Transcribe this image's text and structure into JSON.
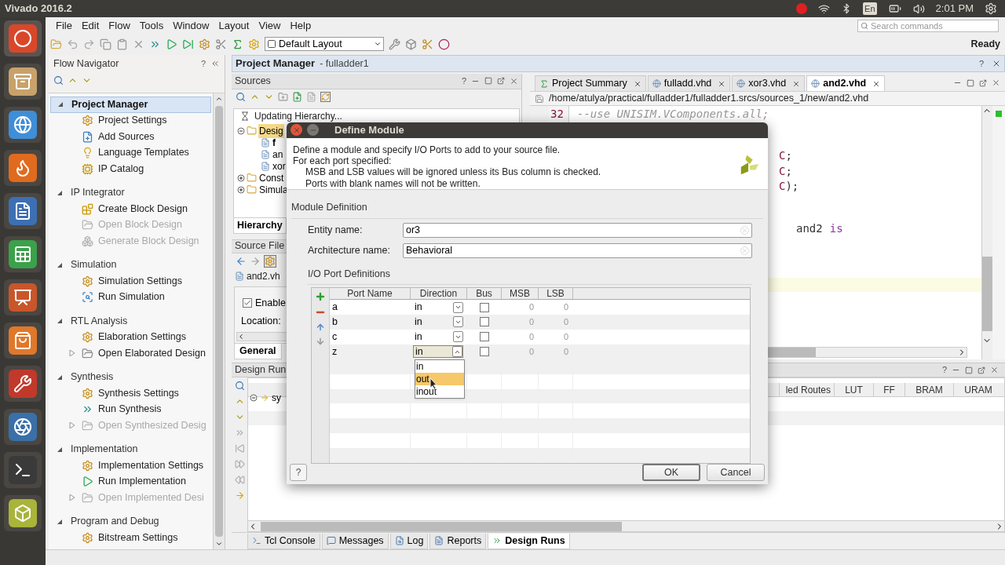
{
  "window": {
    "title": "Vivado 2016.2"
  },
  "system_tray": {
    "keyboard": "En",
    "time": "2:01 PM"
  },
  "menu": [
    "File",
    "Edit",
    "Flow",
    "Tools",
    "Window",
    "Layout",
    "View",
    "Help"
  ],
  "search": {
    "placeholder": "Search commands"
  },
  "toolbar": {
    "layout": "Default Layout",
    "status": "Ready"
  },
  "flow_navigator": {
    "title": "Flow Navigator",
    "help": "?",
    "sections": [
      {
        "label": "Project Manager",
        "selected": true,
        "expanded": true,
        "items": [
          {
            "label": "Project Settings",
            "kind": "settings",
            "disabled": false,
            "expandable": false
          },
          {
            "label": "Add Sources",
            "kind": "add",
            "disabled": false,
            "expandable": false
          },
          {
            "label": "Language Templates",
            "kind": "bulb",
            "disabled": false,
            "expandable": false
          },
          {
            "label": "IP Catalog",
            "kind": "catalog",
            "disabled": false,
            "expandable": false
          }
        ]
      },
      {
        "label": "IP Integrator",
        "selected": false,
        "expanded": true,
        "items": [
          {
            "label": "Create Block Design",
            "kind": "block",
            "disabled": false,
            "expandable": false
          },
          {
            "label": "Open Block Design",
            "kind": "open",
            "disabled": true,
            "expandable": false
          },
          {
            "label": "Generate Block Design",
            "kind": "generate",
            "disabled": true,
            "expandable": false
          }
        ]
      },
      {
        "label": "Simulation",
        "selected": false,
        "expanded": true,
        "items": [
          {
            "label": "Simulation Settings",
            "kind": "settings",
            "disabled": false,
            "expandable": false
          },
          {
            "label": "Run Simulation",
            "kind": "simulate",
            "disabled": false,
            "expandable": false
          }
        ]
      },
      {
        "label": "RTL Analysis",
        "selected": false,
        "expanded": true,
        "items": [
          {
            "label": "Elaboration Settings",
            "kind": "settings",
            "disabled": false,
            "expandable": false
          },
          {
            "label": "Open Elaborated Design",
            "kind": "open",
            "disabled": false,
            "expandable": true
          }
        ]
      },
      {
        "label": "Synthesis",
        "selected": false,
        "expanded": true,
        "items": [
          {
            "label": "Synthesis Settings",
            "kind": "settings",
            "disabled": false,
            "expandable": false
          },
          {
            "label": "Run Synthesis",
            "kind": "synth",
            "disabled": false,
            "expandable": false
          },
          {
            "label": "Open Synthesized Desig",
            "kind": "open",
            "disabled": true,
            "expandable": true
          }
        ]
      },
      {
        "label": "Implementation",
        "selected": false,
        "expanded": true,
        "items": [
          {
            "label": "Implementation Settings",
            "kind": "settings",
            "disabled": false,
            "expandable": false
          },
          {
            "label": "Run Implementation",
            "kind": "run",
            "disabled": false,
            "expandable": false
          },
          {
            "label": "Open Implemented Desi",
            "kind": "open",
            "disabled": true,
            "expandable": true
          }
        ]
      },
      {
        "label": "Program and Debug",
        "selected": false,
        "expanded": true,
        "items": [
          {
            "label": "Bitstream Settings",
            "kind": "settings",
            "disabled": false,
            "expandable": false
          }
        ]
      }
    ]
  },
  "project_header": {
    "title": "Project Manager",
    "project": "- fulladder1",
    "help": "?"
  },
  "sources": {
    "title": "Sources",
    "help": "?",
    "status": "Updating Hierarchy...",
    "tree": [
      {
        "label": "Desig",
        "kind": "folder",
        "selected": true,
        "expanded": true,
        "children": [
          {
            "label": "f",
            "kind": "top",
            "selected": false
          },
          {
            "label": "an",
            "kind": "file",
            "selected": false
          },
          {
            "label": "xor",
            "kind": "file",
            "selected": false
          }
        ]
      },
      {
        "label": "Const",
        "kind": "folder",
        "selected": false,
        "expanded": false
      },
      {
        "label": "Simula",
        "kind": "folder",
        "selected": false,
        "expanded": false
      }
    ],
    "tab": "Hierarchy"
  },
  "source_file_properties": {
    "title": "Source File",
    "file": "and2.vh",
    "enable": {
      "label": "Enable",
      "checked": true
    },
    "location_label": "Location:",
    "tab": "General"
  },
  "editor": {
    "tabs": [
      {
        "label": "Project Summary",
        "kind": "summary",
        "selected": false
      },
      {
        "label": "fulladd.vhd",
        "kind": "file",
        "selected": false
      },
      {
        "label": "xor3.vhd",
        "kind": "file",
        "selected": false
      },
      {
        "label": "and2.vhd",
        "kind": "file",
        "selected": true
      }
    ],
    "path": "/home/atulya/practical/fulladder1/fulladder1.srcs/sources_1/new/and2.vhd",
    "line": {
      "number": "32",
      "text": "--use UNISIM.VComponents.all;"
    },
    "fragments": [
      [
        {
          "text": "C",
          "kind": "type"
        },
        {
          "text": ";",
          "kind": "plain"
        }
      ],
      [
        {
          "text": "C",
          "kind": "type"
        },
        {
          "text": ";",
          "kind": "plain"
        }
      ],
      [
        {
          "text": "C",
          "kind": "type"
        },
        {
          "text": ");",
          "kind": "plain"
        }
      ]
    ],
    "fragment_entity": [
      {
        "text": "and2",
        "kind": "plain"
      },
      {
        "text": "is",
        "kind": "keyword"
      }
    ]
  },
  "design_runs": {
    "title": "Design Run",
    "help": "?",
    "tree": [
      {
        "label": "sy",
        "expanded": true
      }
    ],
    "columns": [
      "led Routes",
      "LUT",
      "FF",
      "BRAM",
      "URAM"
    ]
  },
  "bottom_tabs": [
    {
      "label": "Tcl Console",
      "kind": "console",
      "selected": false
    },
    {
      "label": "Messages",
      "kind": "messages",
      "selected": false
    },
    {
      "label": "Log",
      "kind": "log",
      "selected": false
    },
    {
      "label": "Reports",
      "kind": "reports",
      "selected": false
    },
    {
      "label": "Design Runs",
      "kind": "runs",
      "selected": true
    }
  ],
  "dialog": {
    "title": "Define Module",
    "description": [
      "Define a module and specify I/O Ports to add to your source file.",
      "For each port specified:"
    ],
    "notes": [
      "MSB and LSB values will be ignored unless its Bus column is checked.",
      "Ports with blank names will not be written."
    ],
    "section": "Module Definition",
    "fields": [
      {
        "label": "Entity name:",
        "value": "or3"
      },
      {
        "label": "Architecture name:",
        "value": "Behavioral"
      }
    ],
    "ports_label": "I/O Port Definitions",
    "columns": [
      "Port Name",
      "Direction",
      "Bus",
      "MSB",
      "LSB"
    ],
    "ports": [
      {
        "name": "a",
        "direction": "in",
        "bus": false,
        "msb": "0",
        "lsb": "0",
        "open": false
      },
      {
        "name": "b",
        "direction": "in",
        "bus": false,
        "msb": "0",
        "lsb": "0",
        "open": false
      },
      {
        "name": "c",
        "direction": "in",
        "bus": false,
        "msb": "0",
        "lsb": "0",
        "open": false
      },
      {
        "name": "z",
        "direction": "in",
        "bus": false,
        "msb": "0",
        "lsb": "0",
        "open": true
      }
    ],
    "direction_options": [
      {
        "label": "in",
        "selected": false
      },
      {
        "label": "out",
        "selected": true
      },
      {
        "label": "inout",
        "selected": false
      }
    ],
    "help": "?",
    "buttons": [
      {
        "label": "OK",
        "default": true
      },
      {
        "label": "Cancel",
        "default": false
      }
    ]
  }
}
